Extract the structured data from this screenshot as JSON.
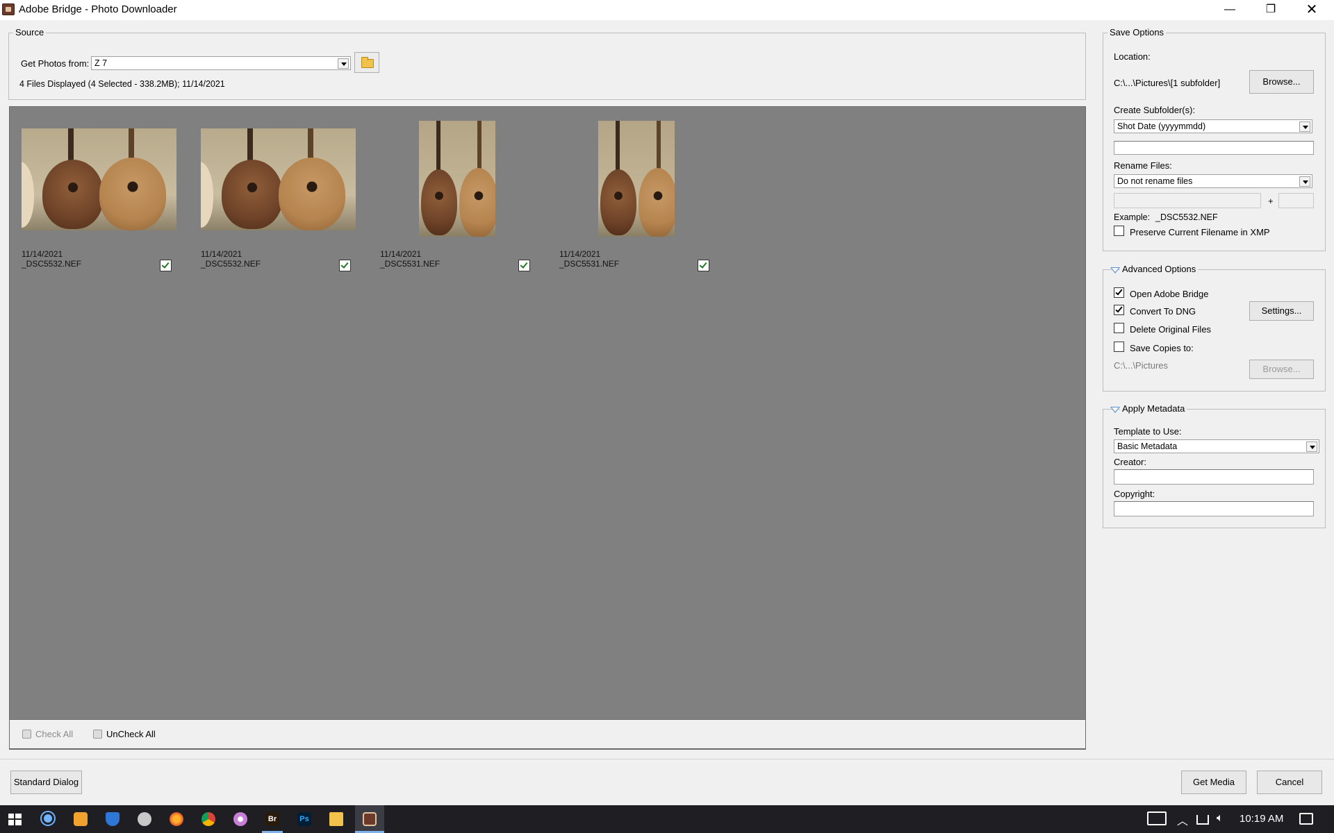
{
  "window": {
    "title": "Adobe Bridge - Photo Downloader",
    "min_glyph": "—",
    "max_glyph": "❐",
    "close_glyph": "✕"
  },
  "source": {
    "legend": "Source",
    "get_photos_label": "Get Photos from:",
    "device": "Z 7",
    "summary": "4 Files Displayed (4 Selected - 338.2MB); 11/14/2021"
  },
  "thumbnails": [
    {
      "date": "11/14/2021",
      "filename": "_DSC5532.NEF",
      "checked": true,
      "orientation": "landscape"
    },
    {
      "date": "11/14/2021",
      "filename": "_DSC5532.NEF",
      "checked": true,
      "orientation": "landscape"
    },
    {
      "date": "11/14/2021",
      "filename": "_DSC5531.NEF",
      "checked": true,
      "orientation": "portrait"
    },
    {
      "date": "11/14/2021",
      "filename": "_DSC5531.NEF",
      "checked": true,
      "orientation": "portrait"
    }
  ],
  "selection_bar": {
    "check_all": "Check All",
    "uncheck_all": "UnCheck All"
  },
  "save_options": {
    "legend": "Save Options",
    "location_label": "Location:",
    "location_value": "C:\\...\\Pictures\\[1 subfolder]",
    "browse": "Browse...",
    "subfolder_label": "Create Subfolder(s):",
    "subfolder_value": "Shot Date (yyyymmdd)",
    "rename_label": "Rename Files:",
    "rename_value": "Do not rename files",
    "plus": "+",
    "example_label": "Example:",
    "example_value": "_DSC5532.NEF",
    "preserve_label": "Preserve Current Filename in XMP",
    "preserve_checked": false
  },
  "advanced_options": {
    "legend": "Advanced Options",
    "open_bridge": "Open Adobe Bridge",
    "open_bridge_checked": true,
    "convert_dng": "Convert To DNG",
    "convert_dng_checked": true,
    "settings": "Settings...",
    "delete_originals": "Delete Original Files",
    "delete_originals_checked": false,
    "save_copies": "Save Copies to:",
    "save_copies_checked": false,
    "copies_path": "C:\\...\\Pictures",
    "browse": "Browse..."
  },
  "apply_metadata": {
    "legend": "Apply Metadata",
    "template_label": "Template to Use:",
    "template_value": "Basic Metadata",
    "creator_label": "Creator:",
    "creator_value": "",
    "copyright_label": "Copyright:",
    "copyright_value": ""
  },
  "footer": {
    "standard_dialog": "Standard Dialog",
    "get_media": "Get Media",
    "cancel": "Cancel"
  },
  "taskbar": {
    "bridge_label": "Br",
    "photoshop_label": "Ps",
    "clock": "10:19 AM"
  },
  "colors": {
    "thumb_bg": "#808080",
    "panel_bg": "#f0f0f0",
    "taskbar_bg": "#1f1f23",
    "accent": "#5a8fd0"
  }
}
